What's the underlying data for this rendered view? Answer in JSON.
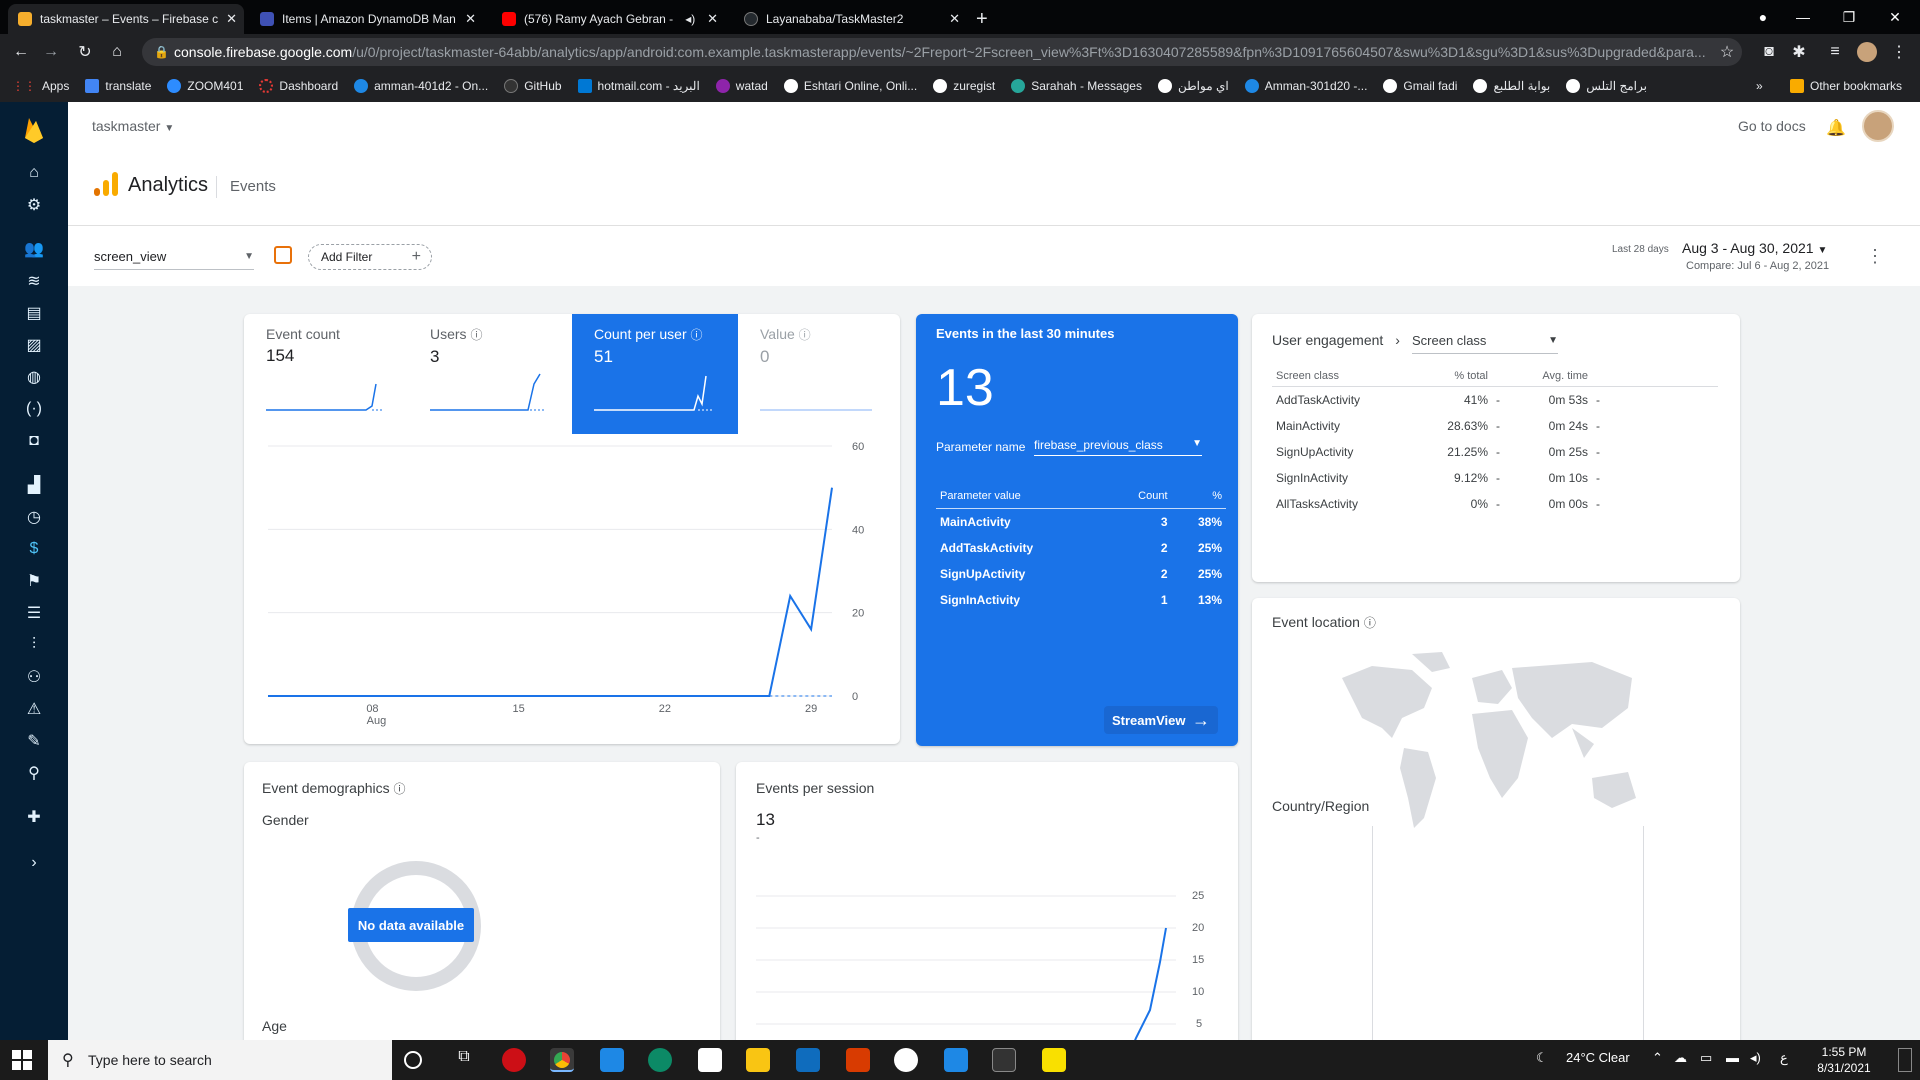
{
  "browser": {
    "tabs": [
      {
        "title": "taskmaster – Events – Firebase c",
        "color": "#f6ae2d"
      },
      {
        "title": "Items | Amazon DynamoDB Man",
        "color": "#3f51b5"
      },
      {
        "title": "(576) Ramy Ayach Gebran -",
        "color": "#ff0000"
      },
      {
        "title": "Layanababa/TaskMaster2",
        "color": "#24292e"
      }
    ],
    "url_host": "console.firebase.google.com",
    "url_path": "/u/0/project/taskmaster-64abb/analytics/app/android:com.example.taskmasterapp/events/~2Freport~2Fscreen_view%3Ft%3D1630407285589&fpn%3D1091765604507&swu%3D1&sgu%3D1&sus%3Dupgraded&para...",
    "bookmarks": [
      "Apps",
      "translate",
      "ZOOM401",
      "Dashboard",
      "amman-401d2 - On...",
      "GitHub",
      "hotmail.com - البريد",
      "watad",
      "Eshtari Online, Onli...",
      "zuregist",
      "Sarahah - Messages",
      "اي مواطن",
      "Amman-301d20 -...",
      "Gmail fadi",
      "بوابة الطلبع",
      "برامج التلس"
    ],
    "other_bookmarks": "Other bookmarks"
  },
  "header": {
    "project": "taskmaster",
    "go_to_docs": "Go to docs",
    "product": "Analytics",
    "crumb": "Events"
  },
  "filters": {
    "event": "screen_view",
    "add_filter": "Add Filter",
    "range_label": "Last 28 days",
    "range": "Aug 3 - Aug 30, 2021",
    "compare": "Compare: Jul 6 - Aug 2, 2021"
  },
  "metrics": [
    {
      "label": "Event count",
      "value": "154"
    },
    {
      "label": "Users",
      "value": "3"
    },
    {
      "label": "Count per user",
      "value": "51"
    },
    {
      "label": "Value",
      "value": "0"
    }
  ],
  "main_chart": {
    "yticks": [
      "60",
      "40",
      "20",
      "0"
    ],
    "xticks": [
      "08",
      "15",
      "22",
      "29"
    ],
    "xsub": "Aug"
  },
  "chart_data": {
    "type": "line",
    "x": [
      "Aug 3",
      "Aug 4",
      "Aug 5",
      "Aug 6",
      "Aug 7",
      "Aug 8",
      "Aug 9",
      "Aug 10",
      "Aug 11",
      "Aug 12",
      "Aug 13",
      "Aug 14",
      "Aug 15",
      "Aug 16",
      "Aug 17",
      "Aug 18",
      "Aug 19",
      "Aug 20",
      "Aug 21",
      "Aug 22",
      "Aug 23",
      "Aug 24",
      "Aug 25",
      "Aug 26",
      "Aug 27",
      "Aug 28",
      "Aug 29",
      "Aug 30"
    ],
    "series": [
      {
        "values": [
          0,
          0,
          0,
          0,
          0,
          0,
          0,
          0,
          0,
          0,
          0,
          0,
          0,
          0,
          0,
          0,
          0,
          0,
          0,
          0,
          0,
          0,
          0,
          0,
          0,
          24,
          16,
          50
        ]
      }
    ],
    "ylim": [
      0,
      60
    ],
    "xlabel": "",
    "ylabel": "",
    "title": ""
  },
  "realtime": {
    "title": "Events in the last 30 minutes",
    "count": "13",
    "param_label": "Parameter name",
    "param_value": "firebase_previous_class",
    "col_value": "Parameter value",
    "col_count": "Count",
    "col_pct": "%",
    "rows": [
      {
        "name": "MainActivity",
        "count": "3",
        "pct": "38%"
      },
      {
        "name": "AddTaskActivity",
        "count": "2",
        "pct": "25%"
      },
      {
        "name": "SignUpActivity",
        "count": "2",
        "pct": "25%"
      },
      {
        "name": "SignInActivity",
        "count": "1",
        "pct": "13%"
      }
    ],
    "stream": "StreamView"
  },
  "engagement": {
    "title": "User engagement",
    "dimension": "Screen class",
    "headers": [
      "Screen class",
      "% total",
      "Avg. time"
    ],
    "rows": [
      {
        "name": "AddTaskActivity",
        "pct": "41%",
        "time": "0m 53s"
      },
      {
        "name": "MainActivity",
        "pct": "28.63%",
        "time": "0m 24s"
      },
      {
        "name": "SignUpActivity",
        "pct": "21.25%",
        "time": "0m 25s"
      },
      {
        "name": "SignInActivity",
        "pct": "9.12%",
        "time": "0m 10s"
      },
      {
        "name": "AllTasksActivity",
        "pct": "0%",
        "time": "0m 00s"
      }
    ],
    "dash": "-"
  },
  "location": {
    "title": "Event location",
    "sub": "Country/Region"
  },
  "demographics": {
    "title": "Event demographics",
    "gender": "Gender",
    "nodata": "No data available",
    "age": "Age"
  },
  "sessions": {
    "title": "Events per session",
    "value": "13",
    "dash": "-",
    "yticks": [
      "25",
      "20",
      "15",
      "10",
      "5"
    ]
  },
  "taskbar": {
    "search": "Type here to search",
    "weather": "24°C  Clear",
    "time": "1:55 PM",
    "date": "8/31/2021"
  }
}
